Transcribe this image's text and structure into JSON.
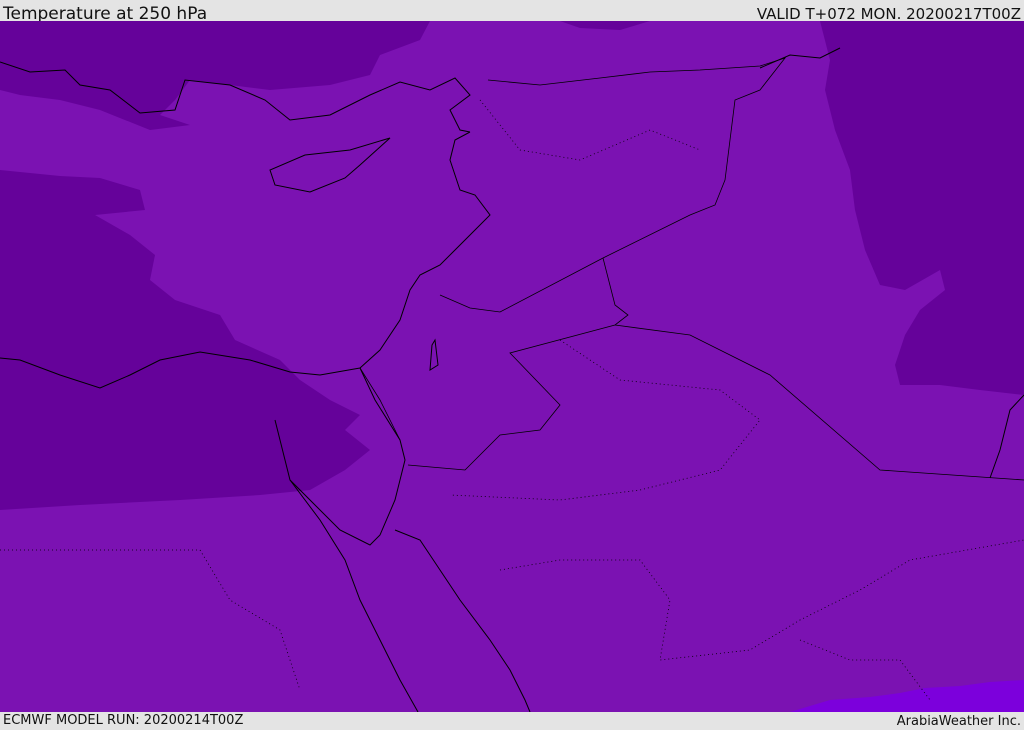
{
  "header": {
    "title": "Temperature at 250 hPa",
    "valid": "VALID T+072 MON. 20200217T00Z"
  },
  "footer": {
    "model_run": "ECMWF MODEL RUN: 20200214T00Z",
    "credit": "ArabiaWeather Inc."
  },
  "colors": {
    "base": "#7b12b2",
    "cold": "#65029a",
    "warm": "#7c00dc",
    "coast": "#000000"
  }
}
